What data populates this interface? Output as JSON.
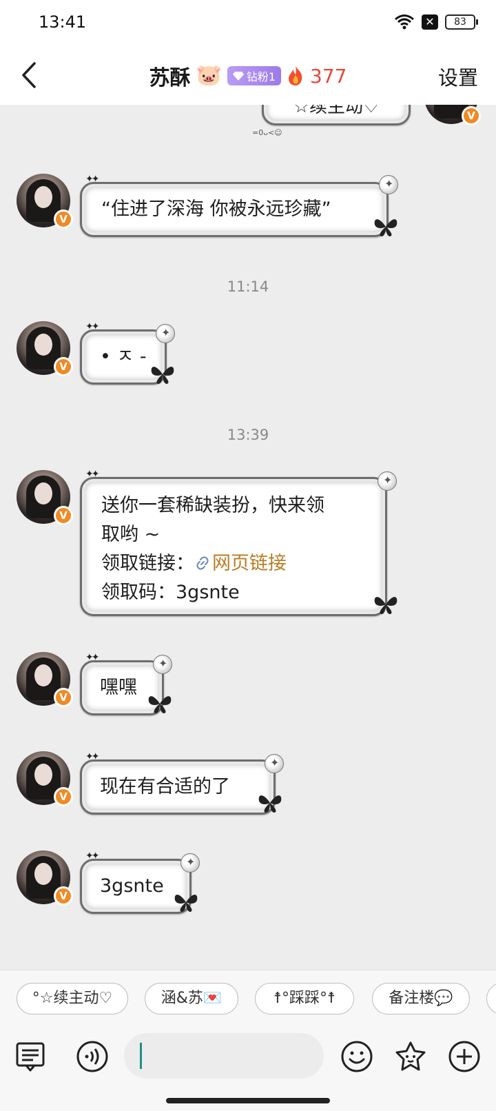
{
  "status_bar": {
    "time": "13:41",
    "battery": "83"
  },
  "header": {
    "title": "苏酥",
    "title_emoji": "🐷",
    "fan_badge": "钻粉1",
    "streak": "377",
    "settings_label": "设置"
  },
  "chat": {
    "top_partial_bubble": "☆续主动♡",
    "top_tiny_text": "=0ᴗ<☺",
    "messages": [
      {
        "text": "“住进了深海 你被永远珍藏”"
      },
      {
        "text": "• ㅈ -"
      },
      {
        "lines": [
          "送你一套稀缺装扮，快来领",
          "取哟 ~"
        ],
        "link_label": "领取链接：",
        "link_text": "网页链接",
        "code_line": "领取码：3gsnte"
      },
      {
        "text": "嘿嘿"
      },
      {
        "text": "现在有合适的了"
      },
      {
        "text": "3gsnte"
      }
    ],
    "timestamps": [
      "11:14",
      "13:39"
    ]
  },
  "quick_replies": [
    "°☆续主动♡",
    "涵&苏💌",
    "☨°踩踩°☨",
    "备注楼💬"
  ],
  "input": {
    "placeholder": ""
  },
  "icons": {
    "back": "back-arrow-icon",
    "list": "menu-list-icon",
    "voice": "voice-icon",
    "emoji": "emoji-icon",
    "sticker": "sticker-star-icon",
    "add": "plus-icon"
  },
  "colors": {
    "streak": "#e8483a",
    "link": "#b87d23",
    "badge_orange": "#f08a24",
    "fan_badge": "#a98bef"
  }
}
